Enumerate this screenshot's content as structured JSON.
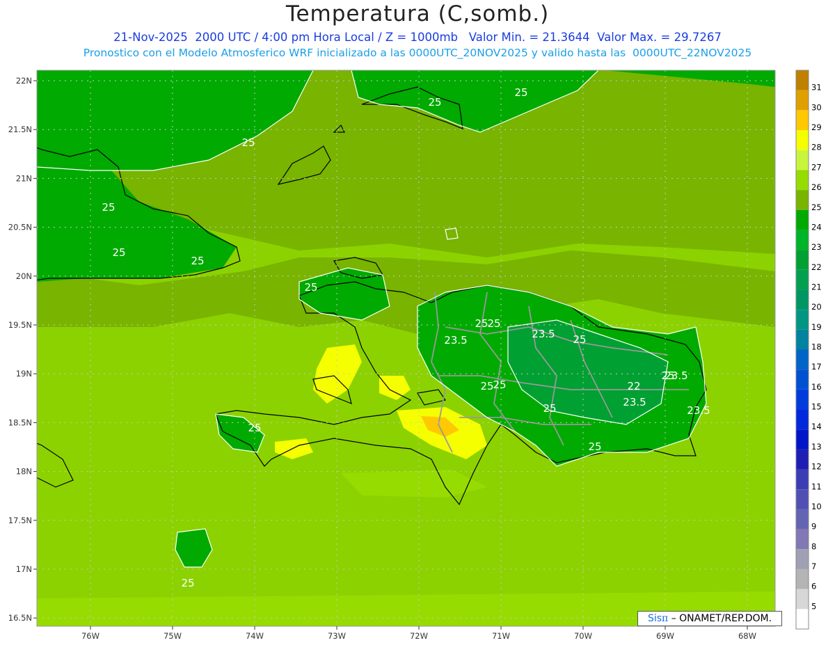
{
  "header": {
    "title": "Temperatura (C,somb.)",
    "line1": "21-Nov-2025  2000 UTC / 4:00 pm Hora Local / Z = 1000mb   Valor Min. = 21.3644  Valor Max. = 29.7267",
    "line2": "Pronostico con el Modelo Atmosferico WRF inicializado a las 0000UTC_20NOV2025 y valido hasta las  0000UTC_22NOV2025"
  },
  "map": {
    "lat_ticks": [
      "22N",
      "21.5N",
      "21N",
      "20.5N",
      "20N",
      "19.5N",
      "19N",
      "18.5N",
      "18N",
      "17.5N",
      "17N",
      "16.5N"
    ],
    "lon_ticks": [
      "76W",
      "75W",
      "74W",
      "73W",
      "72W",
      "71W",
      "70W",
      "69W",
      "68W"
    ],
    "contour_labels": [
      "25",
      "25",
      "25",
      "25",
      "25",
      "25",
      "25",
      "25",
      "23.5",
      "25",
      "23.5",
      "25",
      "25",
      "23.5",
      "22",
      "23.5",
      "23.5",
      "25",
      "25",
      "25",
      "25",
      "25",
      "25"
    ],
    "value_min": 21.3644,
    "value_max": 29.7267
  },
  "legend": {
    "levels": [
      "31",
      "30",
      "29",
      "28",
      "27",
      "26",
      "25",
      "24",
      "23",
      "22",
      "21",
      "20",
      "19",
      "18",
      "17",
      "16",
      "15",
      "14",
      "13",
      "12",
      "11",
      "10",
      "9",
      "8",
      "7",
      "6",
      "5"
    ],
    "colors": [
      "#c08000",
      "#e0a000",
      "#ffc800",
      "#f5ff00",
      "#c8f53c",
      "#96dc00",
      "#78b400",
      "#00aa00",
      "#00b428",
      "#00a032",
      "#00a050",
      "#009664",
      "#009682",
      "#0082a0",
      "#0064c8",
      "#0050d2",
      "#003cdc",
      "#0028dc",
      "#0014c8",
      "#1e1eb4",
      "#3c3cb4",
      "#5050b4",
      "#6464b4",
      "#8278b4",
      "#a0a0b4",
      "#b4b4b4",
      "#d7d7d7",
      "#ffffff"
    ]
  },
  "credit": {
    "prefix": "Sis",
    "pi": "π",
    "suffix": "– ONAMET/REP.DOM."
  }
}
